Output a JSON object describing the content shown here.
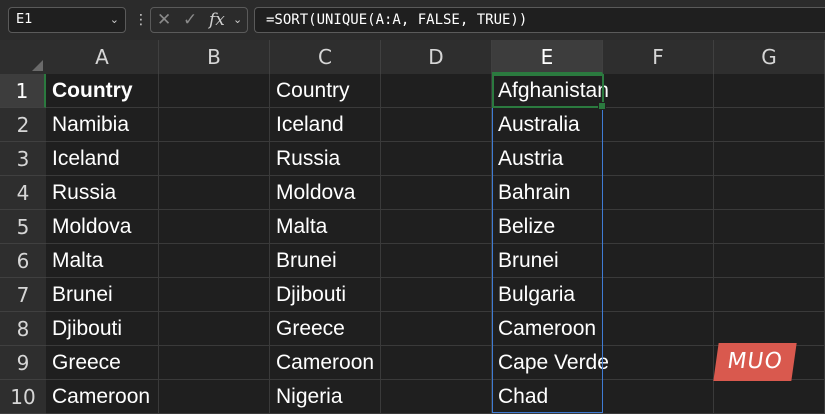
{
  "name_box": {
    "value": "E1"
  },
  "formula_bar": {
    "formula": "=SORT(UNIQUE(A:A, FALSE, TRUE))",
    "fx_label": "fx"
  },
  "columns": [
    "A",
    "B",
    "C",
    "D",
    "E",
    "F",
    "G"
  ],
  "rows": [
    "1",
    "2",
    "3",
    "4",
    "5",
    "6",
    "7",
    "8",
    "9",
    "10"
  ],
  "cells": {
    "A": [
      "Country",
      "Namibia",
      "Iceland",
      "Russia",
      "Moldova",
      "Malta",
      "Brunei",
      "Djibouti",
      "Greece",
      "Cameroon"
    ],
    "C": [
      "Country",
      "Iceland",
      "Russia",
      "Moldova",
      "Malta",
      "Brunei",
      "Djibouti",
      "Greece",
      "Cameroon",
      "Nigeria"
    ],
    "E": [
      "Afghanistan",
      "Australia",
      "Austria",
      "Bahrain",
      "Belize",
      "Brunei",
      "Bulgaria",
      "Cameroon",
      "Cape Verde",
      "Chad"
    ]
  },
  "selection": {
    "active_cell": "E1"
  },
  "watermark": {
    "text": "MUO"
  },
  "colors": {
    "selection_green": "#2b7a3f",
    "spill_blue": "#3f7bd3",
    "logo_red": "#d9594e"
  }
}
